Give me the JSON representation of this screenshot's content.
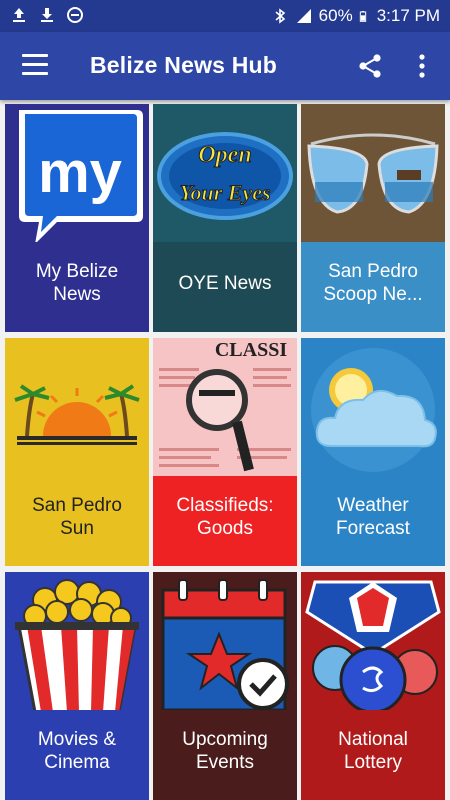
{
  "status_bar": {
    "battery": "60%",
    "time": "3:17 PM",
    "icons": [
      "upload-icon",
      "download-icon",
      "do-not-disturb-icon",
      "bluetooth-icon",
      "signal-icon",
      "battery-icon"
    ]
  },
  "app_bar": {
    "title": "Belize News Hub",
    "menu_icon": "hamburger-menu-icon",
    "share_icon": "share-icon",
    "more_icon": "more-vert-icon"
  },
  "tiles": [
    {
      "label": "My Belize\nNews",
      "image_text": "my",
      "color": "#2f2f8f"
    },
    {
      "label": "OYE News",
      "image_text_1": "Open",
      "image_text_2": "Your Eyes",
      "color": "#1e4a55"
    },
    {
      "label": "San Pedro\nScoop Ne...",
      "color": "#3a8fc7"
    },
    {
      "label": "San Pedro\nSun",
      "color": "#e8c01f"
    },
    {
      "label": "Classifieds:\nGoods",
      "image_text": "CLASSI",
      "color": "#ee2222"
    },
    {
      "label": "Weather\nForecast",
      "color": "#2b84c6"
    },
    {
      "label": "Movies &\nCinema",
      "color": "#2c3fb0"
    },
    {
      "label": "Upcoming\nEvents",
      "color": "#4a1c1c"
    },
    {
      "label": "National\nLottery",
      "color": "#b01a1a"
    }
  ]
}
